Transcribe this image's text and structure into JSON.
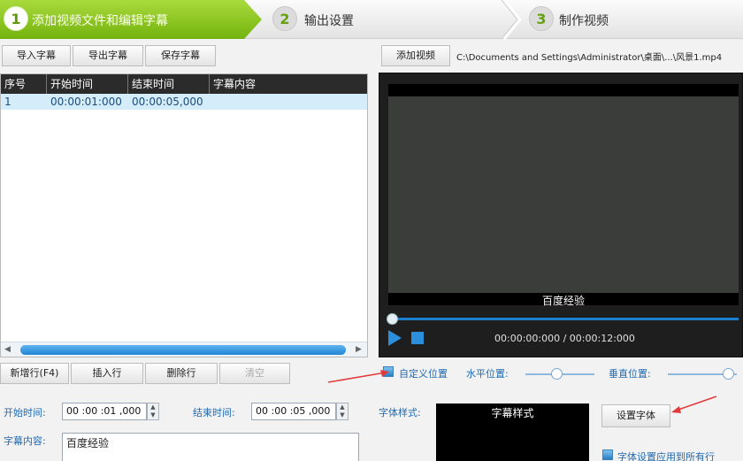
{
  "steps": [
    {
      "num": "1",
      "label": "添加视频文件和编辑字幕",
      "active": true
    },
    {
      "num": "2",
      "label": "输出设置",
      "active": false
    },
    {
      "num": "3",
      "label": "制作视频",
      "active": false
    }
  ],
  "subtitle_toolbar": {
    "import": "导入字幕",
    "export": "导出字幕",
    "save": "保存字幕"
  },
  "table": {
    "columns": [
      "序号",
      "开始时间",
      "结束时间",
      "字幕内容"
    ],
    "rows": [
      {
        "index": "1",
        "start": "00:00:01:000",
        "end": "00:00:05,000",
        "content": ""
      }
    ]
  },
  "video": {
    "add_button": "添加视频",
    "path": "C:\\Documents and Settings\\Administrator\\桌面\\...\\风景1.mp4",
    "subtitle_overlay": "百度经验",
    "time_display": "00:00:00:000 / 00:00:12:000",
    "progress": 0
  },
  "row_actions": {
    "add": "新增行(F4)",
    "insert": "插入行",
    "delete": "删除行",
    "clear": "清空"
  },
  "position": {
    "custom_label": "自定义位置",
    "custom_checked": true,
    "horizontal_label": "水平位置:",
    "horizontal_value": 0.45,
    "vertical_label": "垂直位置:",
    "vertical_value": 0.95
  },
  "editor": {
    "start_label": "开始时间:",
    "start_value": "00 :00 :01 ,000",
    "end_label": "结束时间:",
    "end_value": "00 :00 :05 ,000",
    "content_label": "字幕内容:",
    "content_value": "百度经验"
  },
  "font": {
    "style_label": "字体样式:",
    "preview_text": "字幕样式",
    "set_button": "设置字体",
    "apply_all_label": "字体设置应用到所有行"
  },
  "colors": {
    "accent_green": "#7ab719",
    "accent_blue": "#2c8fdc",
    "annotation_red": "#e23a3a"
  }
}
